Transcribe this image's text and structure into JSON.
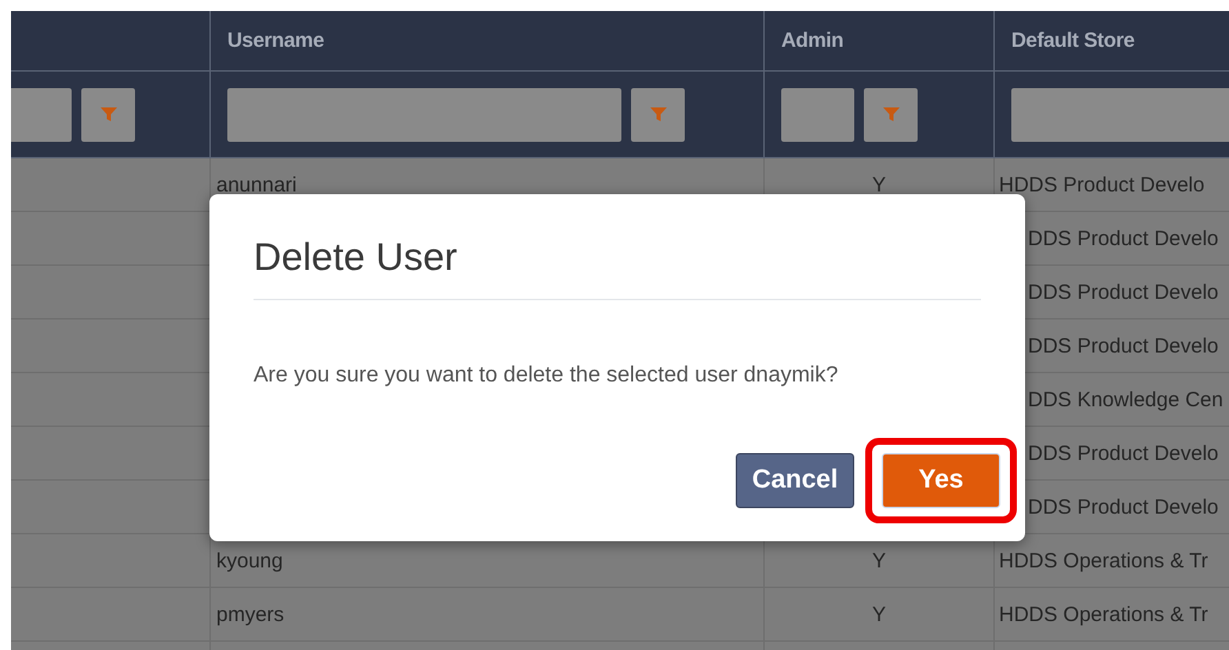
{
  "table": {
    "columns": [
      {
        "label": "Username"
      },
      {
        "label": "Admin"
      },
      {
        "label": "Default Store"
      }
    ],
    "rows": [
      {
        "username": "anunnari",
        "admin": "Y",
        "default_store": "HDDS Product Develo",
        "covered": false
      },
      {
        "default_store": "DDS Product Develo",
        "covered": true
      },
      {
        "default_store": "DDS Product Develo",
        "covered": true
      },
      {
        "default_store": "DDS Product Develo",
        "covered": true
      },
      {
        "default_store": "DDS Knowledge Cen",
        "covered": true
      },
      {
        "default_store": "DDS Product Develo",
        "covered": true
      },
      {
        "default_store": "DDS Product Develo",
        "covered": true
      },
      {
        "username": "kyoung",
        "admin": "Y",
        "default_store": "HDDS Operations & Tr",
        "covered": false
      },
      {
        "username": "pmyers",
        "admin": "Y",
        "default_store": "HDDS Operations & Tr",
        "covered": false
      }
    ]
  },
  "dialog": {
    "title": "Delete User",
    "message": "Are you sure you want to delete the selected user dnaymik?",
    "buttons": [
      {
        "label": "Cancel",
        "kind": "secondary",
        "highlighted": false
      },
      {
        "label": "Yes",
        "kind": "primary",
        "highlighted": true
      }
    ]
  }
}
